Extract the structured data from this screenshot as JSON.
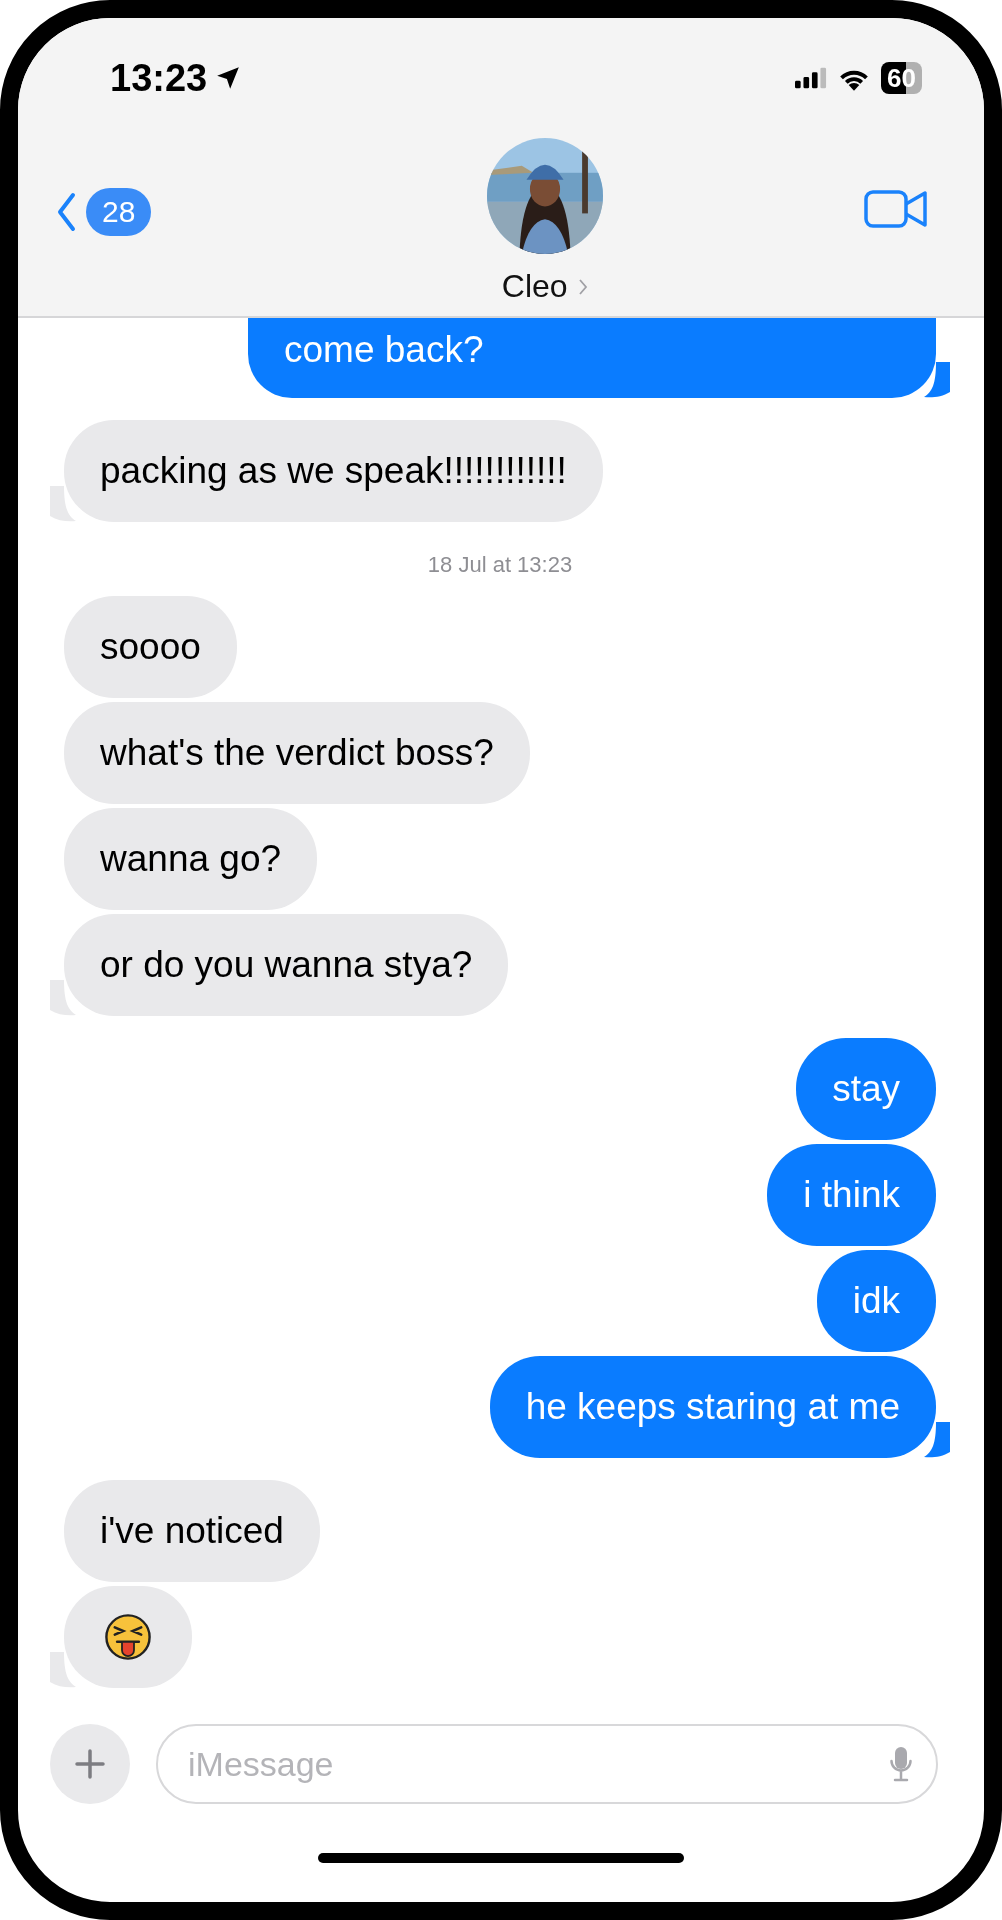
{
  "status_bar": {
    "time": "13:23",
    "battery": "60"
  },
  "header": {
    "back_count": "28",
    "contact_name": "Cleo"
  },
  "messages": [
    {
      "kind": "sent",
      "tail": true,
      "text": "come back?"
    },
    {
      "kind": "received",
      "tail": true,
      "text": "packing as we speak!!!!!!!!!!!!"
    },
    {
      "kind": "timestamp",
      "text": "18 Jul at 13:23"
    },
    {
      "kind": "received",
      "tail": false,
      "text": "soooo"
    },
    {
      "kind": "received",
      "tail": false,
      "text": "what's the verdict boss?"
    },
    {
      "kind": "received",
      "tail": false,
      "text": "wanna go?"
    },
    {
      "kind": "received",
      "tail": true,
      "text": "or do you wanna stya?"
    },
    {
      "kind": "sent",
      "tail": false,
      "text": "stay"
    },
    {
      "kind": "sent",
      "tail": false,
      "text": "i think"
    },
    {
      "kind": "sent",
      "tail": false,
      "text": "idk"
    },
    {
      "kind": "sent",
      "tail": true,
      "text": "he keeps staring at me"
    },
    {
      "kind": "received",
      "tail": false,
      "text": "i've noticed"
    },
    {
      "kind": "received_emoji",
      "tail": true
    }
  ],
  "composer": {
    "placeholder": "iMessage"
  }
}
